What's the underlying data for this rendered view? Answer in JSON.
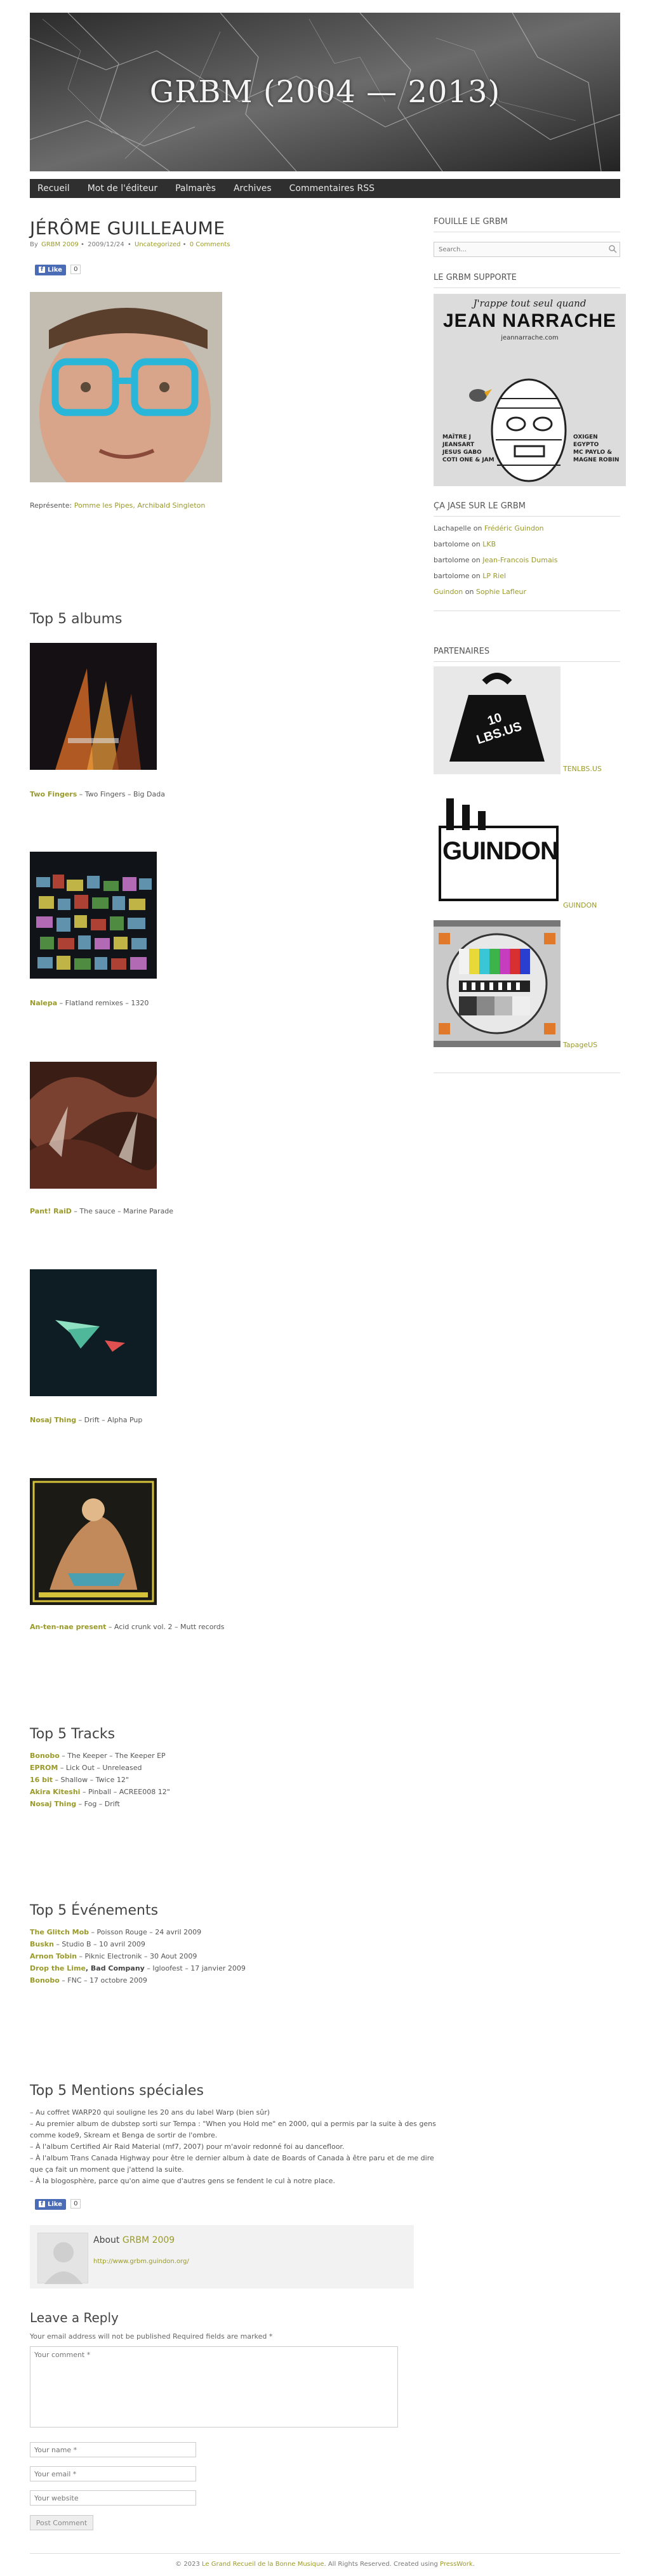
{
  "header": {
    "site_title": "GRBM (2004 — 2013)"
  },
  "nav": {
    "items": [
      "Recueil",
      "Mot de l'éditeur",
      "Palmarès",
      "Archives",
      "Commentaires RSS"
    ]
  },
  "post": {
    "title": "JÉRÔME GUILLEAUME",
    "meta_by": "By",
    "meta_author": "GRBM 2009",
    "meta_sep1": "•",
    "meta_date": "2009/12/24",
    "meta_sep2": "•",
    "meta_category": "Uncategorized",
    "meta_sep3": "•",
    "meta_comments": "0 Comments",
    "like_label": "Like",
    "like_count": "0",
    "represents_label": "Représente:",
    "represents_links": "Pomme les Pipes, Archibald Singleton"
  },
  "albums": {
    "heading": "Top 5 albums",
    "items": [
      {
        "artist": "Two Fingers",
        "rest": " – Two Fingers – Big Dada"
      },
      {
        "artist": "Nalepa",
        "rest": " – Flatland remixes – 1320"
      },
      {
        "artist": "Pant! RaiD",
        "rest": " – The sauce – Marine Parade"
      },
      {
        "artist": "Nosaj Thing",
        "rest": " – Drift – Alpha Pup"
      },
      {
        "artist": "An-ten-nae present",
        "rest": " – Acid crunk vol. 2 – Mutt records"
      }
    ]
  },
  "tracks": {
    "heading": "Top 5 Tracks",
    "items": [
      {
        "artist": "Bonobo",
        "rest": " – The Keeper – The Keeper EP"
      },
      {
        "artist": "EPROM",
        "rest": " – Lick Out – Unreleased"
      },
      {
        "artist": "16 bit",
        "rest": " – Shallow – Twice 12\""
      },
      {
        "artist": "Akira Kiteshi",
        "rest": " – Pinball – ACREE008 12\""
      },
      {
        "artist": "Nosaj Thing",
        "rest": " – Fog – Drift"
      }
    ]
  },
  "events": {
    "heading": "Top 5 Événements",
    "items": [
      {
        "artist": "The Glitch Mob",
        "rest": " – Poisson Rouge – 24 avril 2009"
      },
      {
        "artist": "Buskn",
        "rest": " – Studio B – 10 avril 2009"
      },
      {
        "artist": "Arnon Tobin",
        "rest": " – Piknic Electronik – 30 Aout 2009"
      },
      {
        "artist": "Drop the Lime",
        "rest_b": ", Bad Company",
        "rest": " – Igloofest – 17 janvier 2009"
      },
      {
        "artist": "Bonobo",
        "rest": " – FNC – 17 octobre 2009"
      }
    ]
  },
  "mentions": {
    "heading": "Top 5 Mentions spéciales",
    "lines": [
      "– Au coffret WARP20 qui souligne les 20 ans du label Warp (bien sûr)",
      "– Au premier album de dubstep sorti sur Tempa : \"When you Hold me\" en 2000, qui a permis par la suite à des gens comme kode9, Skream et Benga de sortir de l'ombre.",
      "– À l'album Certified Air Raid Material (mf7, 2007) pour m'avoir redonné foi au dancefloor.",
      "– À l'album Trans Canada Highway pour être le dernier album à date de Boards of Canada à être paru et de me dire que ça fait un moment que j'attend la suite.",
      "– À la blogosphère, parce qu'on aime que d'autres gens se fendent le cul à notre place."
    ]
  },
  "author": {
    "about_label": "About",
    "about_name": "GRBM 2009",
    "url": "http://www.grbm.guindon.org/"
  },
  "comment_form": {
    "heading": "Leave a Reply",
    "note": "Your email address will not be published Required fields are marked *",
    "comment_placeholder": "Your comment *",
    "name_placeholder": "Your name *",
    "email_placeholder": "Your email *",
    "website_placeholder": "Your website",
    "submit_label": "Post Comment"
  },
  "sidebar": {
    "search_heading": "Fouille le GRBM",
    "search_placeholder": "Search...",
    "support_heading": "Le GRBM supporte",
    "support_img_title": "J'rappe tout seul quand",
    "support_img_name": "JEAN NARRACHE",
    "support_img_url": "jeannarrache.com",
    "support_img_left1": "MAÎTRE J",
    "support_img_left2": "JEANSART",
    "support_img_left3": "JESUS GABO",
    "support_img_left4": "COTI ONE & JAM",
    "support_img_right1": "OXIGEN",
    "support_img_right2": "EGYPTO",
    "support_img_right3": "MC PAYLO &",
    "support_img_right4": "MAGNE ROBIN",
    "jase_heading": "Ça jase sur le GRBM",
    "jase": [
      {
        "who": "Lachapelle",
        "on": " on ",
        "what": "Frédéric Guindon"
      },
      {
        "who": "bartolome",
        "on": " on ",
        "what": "LKB"
      },
      {
        "who": "bartolome",
        "on": " on ",
        "what": "Jean-Francois Dumais"
      },
      {
        "who": "bartolome",
        "on": " on ",
        "what": "LP Riel"
      },
      {
        "who": "Guindon",
        "on": " on ",
        "what": "Sophie Lafleur"
      }
    ],
    "partners_heading": "Partenaires",
    "partners": [
      {
        "label": "TENLBS.US",
        "img_text": "10 LBS.US"
      },
      {
        "label": "GUINDON",
        "img_text": "GUINDON"
      },
      {
        "label": "TapageUS",
        "img_text": ""
      }
    ]
  },
  "footer": {
    "text_pre": "© 2023 ",
    "site_link": "Le Grand Recueil de la Bonne Musique",
    "text_mid": ". All Rights Reserved. Created using ",
    "theme_link": "PressWork",
    "text_post": "."
  }
}
